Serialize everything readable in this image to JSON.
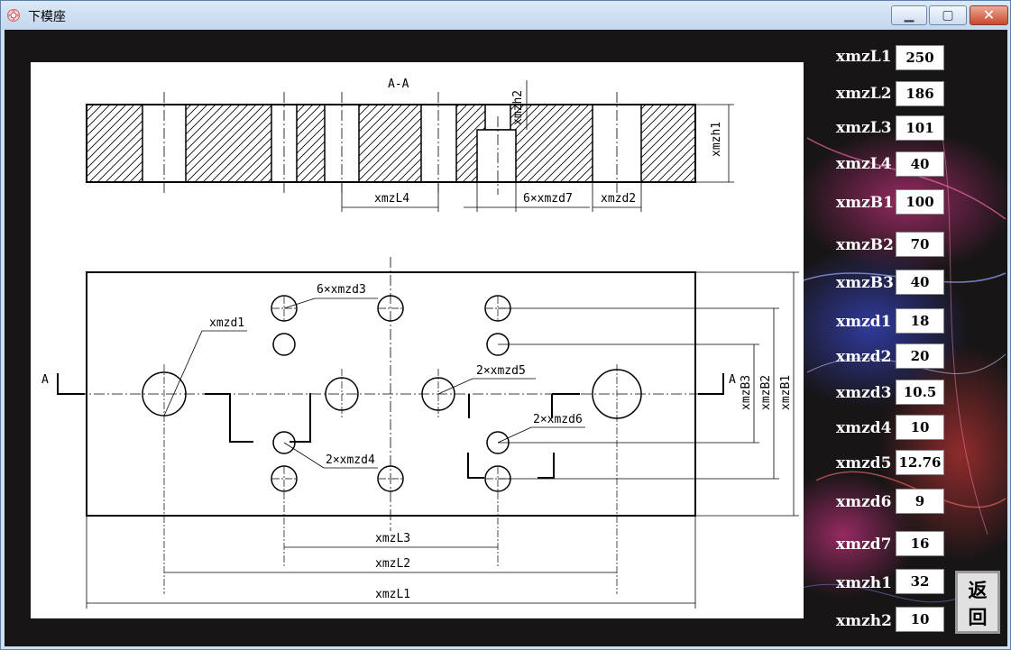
{
  "window": {
    "title": "下模座",
    "icon": "app-icon",
    "controls": {
      "minimize": "minimize-icon",
      "maximize": "maximize-icon",
      "close": "close-icon"
    }
  },
  "drawing": {
    "section_title": "A-A",
    "section_marker": "A",
    "dims": {
      "h1": "xmzh1",
      "h2": "xmzh2",
      "L4": "xmzL4",
      "d7": "6×xmzd7",
      "d2": "xmzd2",
      "d1": "xmzd1",
      "d3": "6×xmzd3",
      "d5": "2×xmzd5",
      "d6": "2×xmzd6",
      "d4": "2×xmzd4",
      "B3": "xmzB3",
      "B2": "xmzB2",
      "B1": "xmzB1",
      "L3": "xmzL3",
      "L2": "xmzL2",
      "L1": "xmzL1"
    }
  },
  "params": [
    {
      "label": "xmzL1",
      "value": "250"
    },
    {
      "label": "xmzL2",
      "value": "186"
    },
    {
      "label": "xmzL3",
      "value": "101"
    },
    {
      "label": "xmzL4",
      "value": "40"
    },
    {
      "label": "xmzB1",
      "value": "100"
    },
    {
      "label": "xmzB2",
      "value": "70"
    },
    {
      "label": "xmzB3",
      "value": "40"
    },
    {
      "label": "xmzd1",
      "value": "18"
    },
    {
      "label": "xmzd2",
      "value": "20"
    },
    {
      "label": "xmzd3",
      "value": "10.5"
    },
    {
      "label": "xmzd4",
      "value": "10"
    },
    {
      "label": "xmzd5",
      "value": "12.76"
    },
    {
      "label": "xmzd6",
      "value": "9"
    },
    {
      "label": "xmzd7",
      "value": "16"
    },
    {
      "label": "xmzh1",
      "value": "32"
    },
    {
      "label": "xmzh2",
      "value": "10"
    }
  ],
  "back_button": {
    "label": "返回"
  }
}
